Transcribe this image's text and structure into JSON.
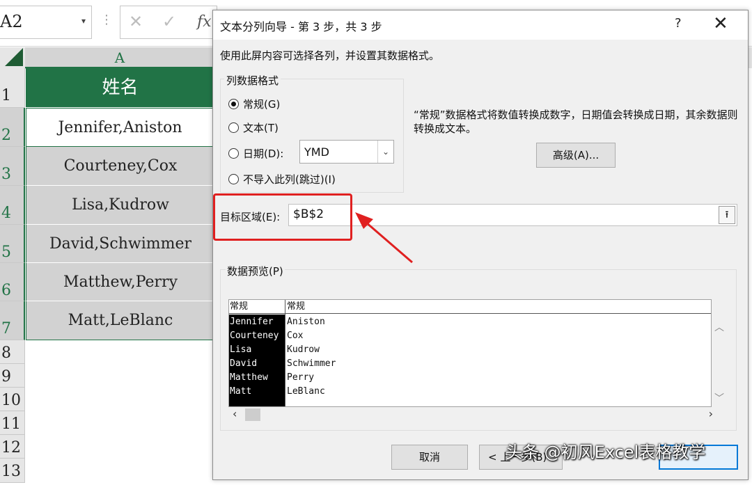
{
  "excel": {
    "name_box": "A2",
    "column_header": "A",
    "rows": [
      {
        "num": "1",
        "value": "姓名"
      },
      {
        "num": "2",
        "value": "Jennifer,Aniston"
      },
      {
        "num": "3",
        "value": "Courteney,Cox"
      },
      {
        "num": "4",
        "value": "Lisa,Kudrow"
      },
      {
        "num": "5",
        "value": "David,Schwimmer"
      },
      {
        "num": "6",
        "value": "Matthew,Perry"
      },
      {
        "num": "7",
        "value": "Matt,LeBlanc"
      },
      {
        "num": "8",
        "value": ""
      },
      {
        "num": "9",
        "value": ""
      },
      {
        "num": "10",
        "value": ""
      },
      {
        "num": "11",
        "value": ""
      },
      {
        "num": "12",
        "value": ""
      },
      {
        "num": "13",
        "value": ""
      }
    ],
    "header_color": "#217346"
  },
  "dialog": {
    "title": "文本分列向导 - 第 3 步，共 3 步",
    "help": "?",
    "close": "✕",
    "instruction": "使用此屏内容可选择各列，并设置其数据格式。",
    "format_group_title": "列数据格式",
    "options": [
      {
        "label": "常规(G)",
        "selected": true
      },
      {
        "label": "文本(T)",
        "selected": false
      },
      {
        "label": "日期(D):",
        "selected": false
      },
      {
        "label": "不导入此列(跳过)(I)",
        "selected": false
      }
    ],
    "date_format": "YMD",
    "description": "“常规”数据格式将数值转换成数字，日期值会转换成日期，其余数据则转换成文本。",
    "advanced_button": "高级(A)...",
    "destination_label": "目标区域(E):",
    "destination_value": "$B$2",
    "preview_title": "数据预览(P)",
    "preview_headers": [
      "常规",
      "常规"
    ],
    "preview_rows": [
      [
        "Jennifer",
        "Aniston"
      ],
      [
        "Courteney",
        "Cox"
      ],
      [
        "Lisa",
        "Kudrow"
      ],
      [
        "David",
        "Schwimmer"
      ],
      [
        "Matthew",
        "Perry"
      ],
      [
        "Matt",
        "LeBlanc"
      ]
    ],
    "cancel_button": "取消",
    "back_button": "< 上一步(B)",
    "highlight_color": "#e02020"
  },
  "watermark": "头条 @初风Excel表格教学"
}
